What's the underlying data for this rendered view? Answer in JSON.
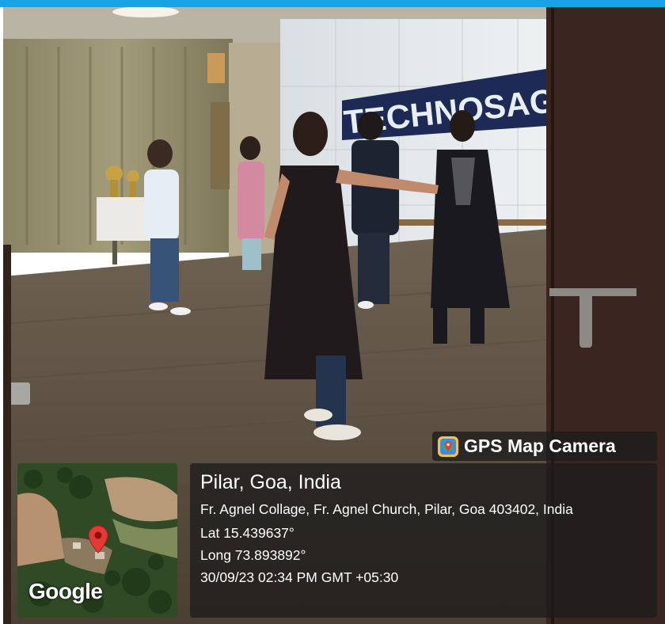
{
  "photo": {
    "banner_text": "TECHNOSAGA"
  },
  "badge": {
    "icon": "gps-map-camera-icon",
    "label": "GPS Map Camera"
  },
  "map": {
    "logo": "Google",
    "pin_color": "#e53935"
  },
  "location": {
    "place": "Pilar, Goa, India",
    "address": "Fr. Agnel Collage, Fr. Agnel Church, Pilar, Goa 403402, India",
    "lat": "Lat 15.439637°",
    "long": "Long 73.893892°",
    "timestamp": "30/09/23 02:34 PM GMT +05:30"
  },
  "colors": {
    "top_bar": "#17a3e6",
    "overlay": "rgba(28,28,28,0.78)",
    "text": "#ffffff"
  }
}
